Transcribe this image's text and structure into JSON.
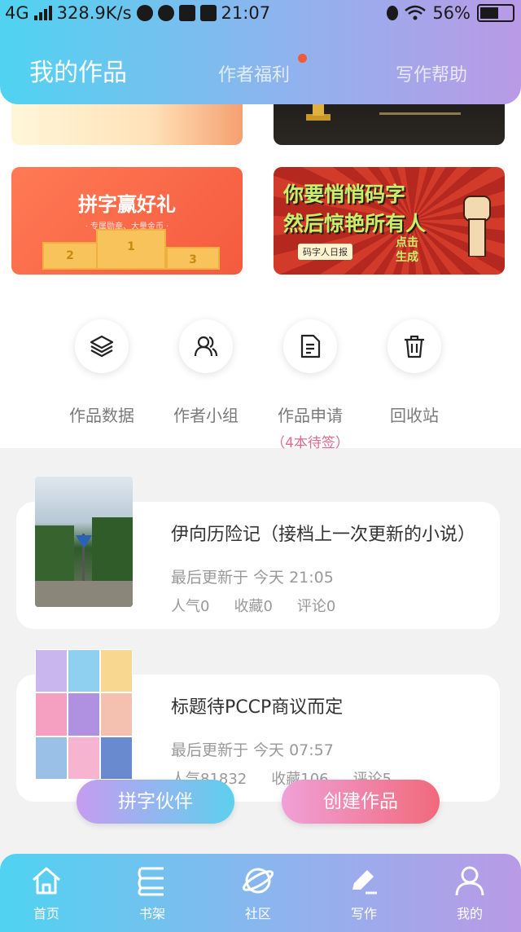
{
  "status_bar": {
    "network": "4G",
    "speed": "328.9K/s",
    "time": "21:07",
    "battery": "56%"
  },
  "header": {
    "tabs": [
      {
        "label": "我的作品",
        "active": true
      },
      {
        "label": "作者福利",
        "has_dot": true
      },
      {
        "label": "写作帮助"
      }
    ]
  },
  "banners": [
    {
      "title": "拼字赢好礼",
      "subtitle": "· 专属勋章、大量金币 ·",
      "ranks": [
        "1",
        "2",
        "3"
      ]
    },
    {
      "line1": "你要悄悄码字",
      "line2": "然后惊艳所有人",
      "tag": "码字人日报",
      "cta": "点击生成"
    }
  ],
  "quick_menu": [
    {
      "icon": "layers-icon",
      "label": "作品数据"
    },
    {
      "icon": "group-icon",
      "label": "作者小组"
    },
    {
      "icon": "document-icon",
      "label": "作品申请",
      "sub": "（4本待签）"
    },
    {
      "icon": "trash-icon",
      "label": "回收站"
    }
  ],
  "works": [
    {
      "title": "伊向历险记（接档上一次更新的小说）",
      "updated": "最后更新于 今天 21:05",
      "popularity": "人气0",
      "favorites": "收藏0",
      "comments": "评论0"
    },
    {
      "title": "标题待PCCP商议而定",
      "updated": "最后更新于 今天 07:57",
      "popularity": "人气81832",
      "favorites": "收藏106",
      "comments": "评论5"
    }
  ],
  "actions": {
    "partner": "拼字伙伴",
    "create": "创建作品"
  },
  "bottom_nav": [
    {
      "icon": "home-icon",
      "label": "首页"
    },
    {
      "icon": "bookshelf-icon",
      "label": "书架"
    },
    {
      "icon": "planet-icon",
      "label": "社区"
    },
    {
      "icon": "pen-icon",
      "label": "写作"
    },
    {
      "icon": "user-icon",
      "label": "我的"
    }
  ],
  "colors": {
    "gradient_start": "#4fd3f0",
    "gradient_end": "#b99ae6",
    "accent_pink": "#e06b8a",
    "notification_dot": "#ef5a3c"
  }
}
